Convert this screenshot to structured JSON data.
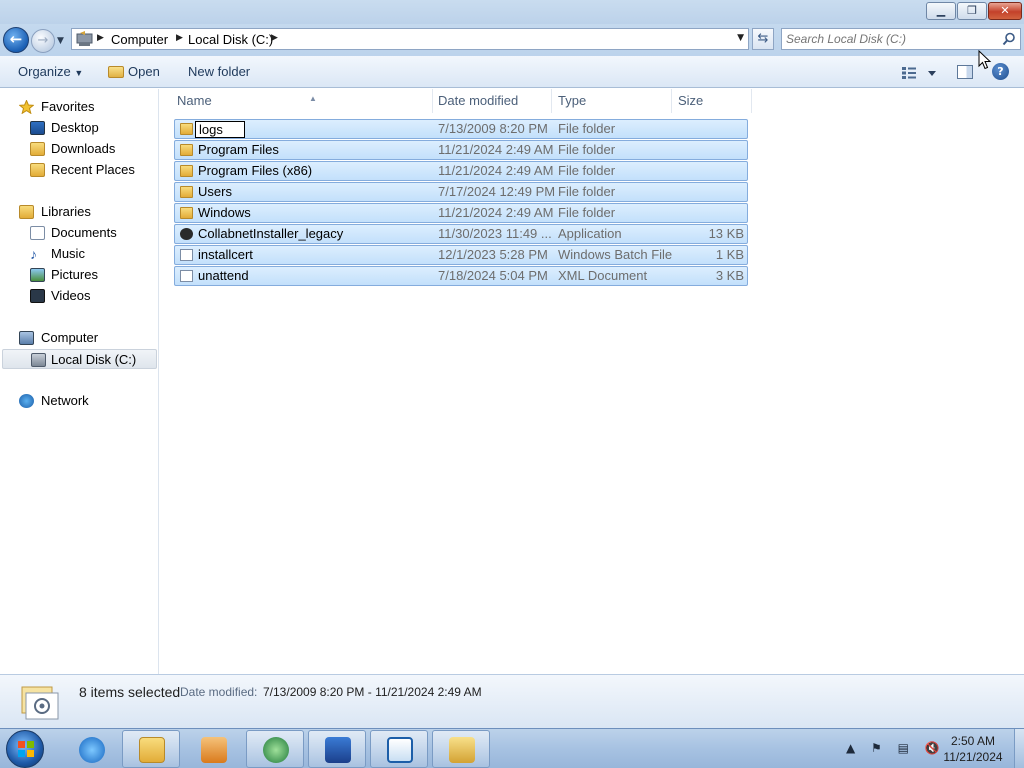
{
  "window": {
    "minimize_label": "▁",
    "maximize_label": "❐",
    "close_label": "✕"
  },
  "address": {
    "crumbs": [
      "Computer",
      "Local Disk (C:)"
    ],
    "search_placeholder": "Search Local Disk (C:)"
  },
  "toolbar": {
    "organize_label": "Organize",
    "open_label": "Open",
    "newfolder_label": "New folder",
    "help_label": "?"
  },
  "nav": {
    "favorites": "Favorites",
    "desktop": "Desktop",
    "downloads": "Downloads",
    "recent_places": "Recent Places",
    "libraries": "Libraries",
    "documents": "Documents",
    "music": "Music",
    "pictures": "Pictures",
    "videos": "Videos",
    "computer": "Computer",
    "local_disk": "Local Disk (C:)",
    "network": "Network"
  },
  "columns": {
    "name": "Name",
    "date_modified": "Date modified",
    "type": "Type",
    "size": "Size"
  },
  "files": [
    {
      "name": "logs",
      "date": "7/13/2009 8:20 PM",
      "type": "File folder",
      "size": "",
      "icon": "folder-icon"
    },
    {
      "name": "Program Files",
      "date": "11/21/2024 2:49 AM",
      "type": "File folder",
      "size": "",
      "icon": "folder-icon"
    },
    {
      "name": "Program Files (x86)",
      "date": "11/21/2024 2:49 AM",
      "type": "File folder",
      "size": "",
      "icon": "folder-icon"
    },
    {
      "name": "Users",
      "date": "7/17/2024 12:49 PM",
      "type": "File folder",
      "size": "",
      "icon": "folder-icon"
    },
    {
      "name": "Windows",
      "date": "11/21/2024 2:49 AM",
      "type": "File folder",
      "size": "",
      "icon": "folder-icon"
    },
    {
      "name": "CollabnetInstaller_legacy",
      "date": "11/30/2023 11:49 ...",
      "type": "Application",
      "size": "13 KB",
      "icon": "application-icon"
    },
    {
      "name": "installcert",
      "date": "12/1/2023 5:28 PM",
      "type": "Windows Batch File",
      "size": "1 KB",
      "icon": "batch-file-icon"
    },
    {
      "name": "unattend",
      "date": "7/18/2024 5:04 PM",
      "type": "XML Document",
      "size": "3 KB",
      "icon": "xml-document-icon"
    }
  ],
  "rename": {
    "value": "logs"
  },
  "details": {
    "count": "8 items selected",
    "date_label": "Date modified:",
    "date_value": "7/13/2009 8:20 PM - 11/21/2024 2:49 AM"
  },
  "taskbar": {
    "time": "2:50 AM",
    "date": "11/21/2024",
    "tray_icons": "▲ ⚑ ▤ 🔇"
  },
  "colors": {
    "selection_fill": "#c3e0fb",
    "selection_border": "#84acdd",
    "chrome_blue": "#bcd3ec"
  }
}
